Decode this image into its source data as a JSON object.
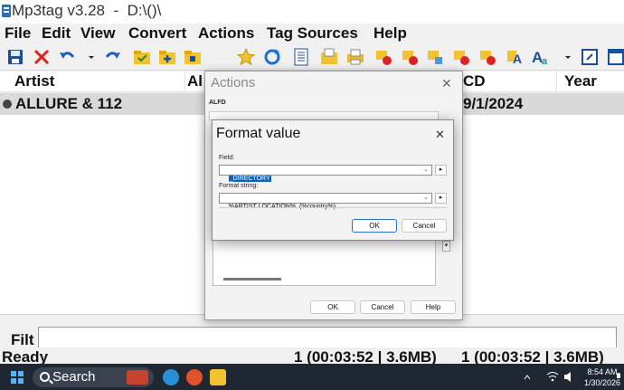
{
  "window": {
    "title": "Mp3tag v3.28  -  D:\\()\\"
  },
  "menu": [
    "File",
    "Edit",
    "View",
    "Convert",
    "Actions",
    "Tag Sources",
    "Help"
  ],
  "toolbar_icons": [
    "save-icon",
    "remove-tag-icon",
    "undo-icon",
    "dropdown-icon",
    "redo-icon",
    "open-folder-icon",
    "add-folder-icon",
    "playlist-folder-icon",
    "favorite-star-icon",
    "refresh-icon",
    "tag-panel-icon",
    "export-icon",
    "print-icon",
    "tag-filename-icon",
    "filename-tag-icon",
    "text-tag-icon",
    "tag-tag-icon",
    "autonumber-icon",
    "case-conversion-icon",
    "convert-case-icon",
    "options-icon",
    "more-icon"
  ],
  "columns": {
    "artist": "Artist",
    "album": "Al",
    "cd": "CD",
    "year": "Year"
  },
  "rows": [
    {
      "artist": "ALLURE & 112",
      "cd": "9/1/2024"
    }
  ],
  "filter": {
    "label": "Filt",
    "value": ""
  },
  "status": {
    "ready": "Ready",
    "selection": "1 (00:03:52 | 3.6MB)",
    "total": "1 (00:03:52 | 3.6MB)"
  },
  "actions_dialog": {
    "title": "Actions",
    "name_label": "ALFD",
    "ok": "OK",
    "cancel": "Cancel",
    "help": "Help"
  },
  "format_dialog": {
    "title": "Format value",
    "field_label": "Field:",
    "field_value": "_DIRECTORY",
    "format_label": "Format string:",
    "format_value": "%ARTIST LOCATION%  (%country%)",
    "ok": "OK",
    "cancel": "Cancel"
  },
  "taskbar": {
    "search_placeholder": "Search",
    "time": "8:54 AM",
    "date": "1/30/2026"
  }
}
